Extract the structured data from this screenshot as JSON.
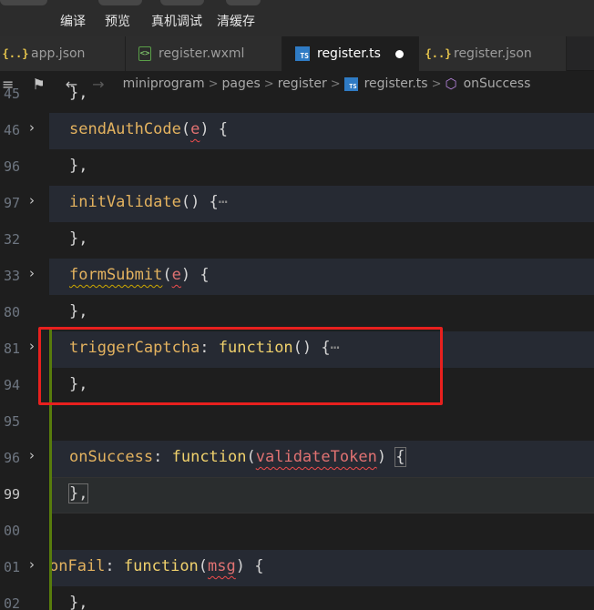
{
  "toolbar": {
    "buttons": [
      {
        "label": "编译"
      },
      {
        "label": "预览"
      },
      {
        "label": "真机调试"
      },
      {
        "label": "清缓存"
      }
    ]
  },
  "tabs": [
    {
      "label": "app.json",
      "icon": "json-braces-icon",
      "glyph": "{..}"
    },
    {
      "label": "register.wxml",
      "icon": "wxml-file-icon",
      "glyph": "<>"
    },
    {
      "label": "register.ts",
      "icon": "ts-file-icon",
      "glyph": "TS",
      "active": true,
      "modified": true
    },
    {
      "label": "register.json",
      "icon": "json-braces-icon",
      "glyph": "{..}"
    }
  ],
  "breadcrumb": {
    "items": [
      "miniprogram",
      "pages",
      "register"
    ],
    "file": "register.ts",
    "file_glyph": "TS",
    "symbol": "onSuccess",
    "separator": ">"
  },
  "editor": {
    "lines": [
      {
        "num": "45",
        "text": "},"
      },
      {
        "num": "46",
        "name": "sendAuthCode",
        "param": "e",
        "tail": ") {"
      },
      {
        "num": "96",
        "text": "},"
      },
      {
        "num": "97",
        "name": "initValidate",
        "tail": "() {",
        "ellipsis": "⋯"
      },
      {
        "num": "32",
        "text": "},"
      },
      {
        "num": "33",
        "name": "formSubmit",
        "param": "e",
        "tail": ") {"
      },
      {
        "num": "80",
        "text": "},"
      },
      {
        "num": "81",
        "name": "triggerCaptcha",
        "keyword": "function",
        "tail": "() {",
        "ellipsis": "⋯"
      },
      {
        "num": "94",
        "text": "},"
      },
      {
        "num": "95",
        "text": ""
      },
      {
        "num": "96",
        "name": "onSuccess",
        "keyword": "function",
        "param": "validateToken",
        "tail": "{"
      },
      {
        "num": "99",
        "text": "},"
      },
      {
        "num": "00",
        "text": ""
      },
      {
        "num": "01",
        "name": "onFail",
        "keyword": "function",
        "param": "msg",
        "tail": ") {"
      },
      {
        "num": "02",
        "text": "},"
      }
    ]
  }
}
